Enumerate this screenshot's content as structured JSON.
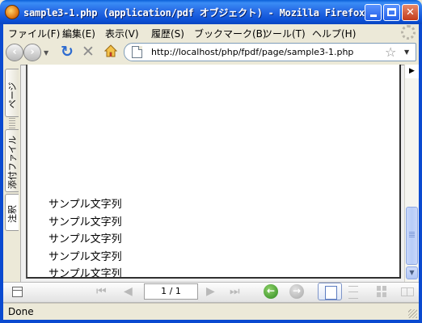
{
  "window": {
    "title": "sample3-1.php (application/pdf オブジェクト) - Mozilla Firefox",
    "min_label": "",
    "max_label": "",
    "close_label": "✕"
  },
  "menu": {
    "items": [
      "ファイル(F)",
      "編集(E)",
      "表示(V)",
      "履歴(S)",
      "ブックマーク(B)",
      "ツール(T)",
      "ヘルプ(H)"
    ]
  },
  "nav": {
    "back_glyph": "‹",
    "forward_glyph": "›",
    "reload_glyph": "↻",
    "stop_glyph": "✕",
    "url": "http://localhost/php/fpdf/page/sample3-1.php",
    "star_glyph": "☆",
    "dropdown_glyph": "▼"
  },
  "sidebar": {
    "tabs": [
      "ページ",
      "添付ファイル",
      "注釈"
    ]
  },
  "pdf": {
    "lines": [
      "サンプル文字列",
      "サンプル文字列",
      "サンプル文字列",
      "サンプル文字列",
      "サンプル文字列"
    ]
  },
  "scrollbar": {
    "up_glyph": "▶",
    "down_glyph": "▼"
  },
  "pdf_toolbar": {
    "first_glyph": "⏮",
    "prev_glyph": "◀",
    "page_indicator": "1 / 1",
    "next_glyph": "▶",
    "last_glyph": "⏭",
    "prev_view_glyph": "←",
    "next_view_glyph": "→"
  },
  "status": {
    "text": "Done"
  },
  "colors": {
    "titlebar": "#0b4fd4",
    "accent": "#2d6bd0"
  }
}
